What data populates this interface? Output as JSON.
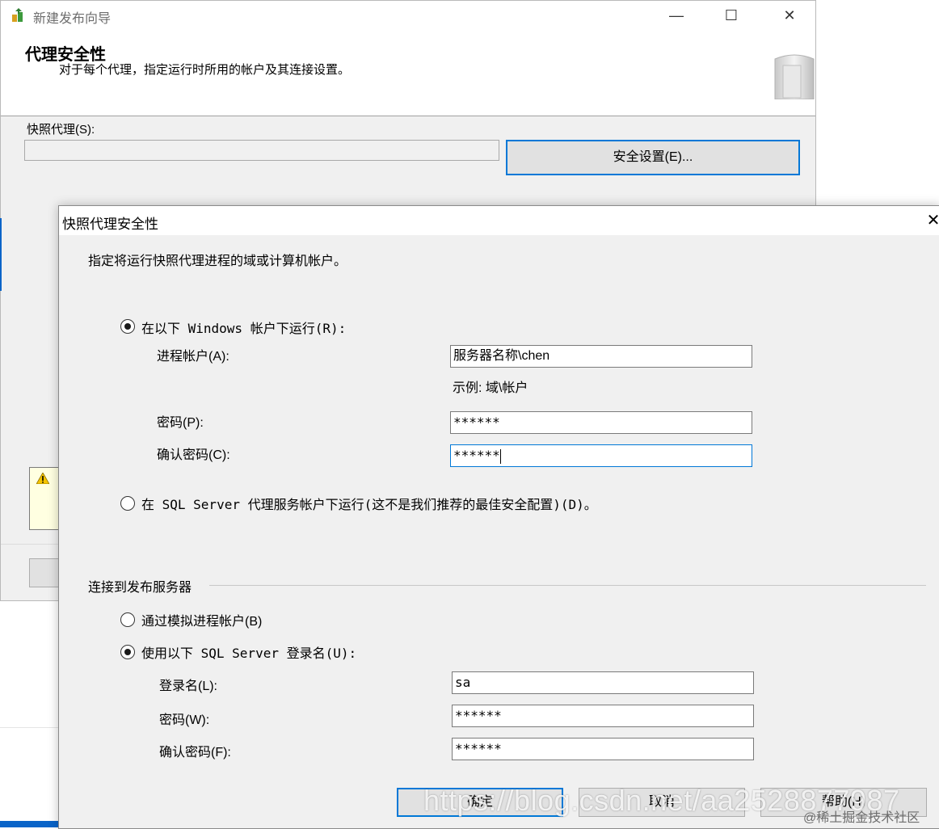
{
  "wizard": {
    "title": "新建发布向导",
    "header_title": "代理安全性",
    "header_desc": "对于每个代理，指定运行时所用的帐户及其连接设置。",
    "snapshot_agent_label": "快照代理(S):",
    "snapshot_agent_value": "",
    "security_settings_button": "安全设置(E)...",
    "minimize_glyph": "—",
    "maximize_glyph": "☐",
    "close_glyph": "✕"
  },
  "dialog": {
    "title": "快照代理安全性",
    "close_glyph": "✕",
    "instruction": "指定将运行快照代理进程的域或计算机帐户。",
    "process_account": {
      "radio_windows_label": "在以下 Windows 帐户下运行(R):",
      "account_label": "进程帐户(A):",
      "account_value": "服务器名称\\chen",
      "example_text": "示例: 域\\帐户",
      "password_label": "密码(P):",
      "password_value": "******",
      "confirm_label": "确认密码(C):",
      "confirm_value": "******",
      "radio_sqlagent_label": "在 SQL Server 代理服务帐户下运行(这不是我们推荐的最佳安全配置)(D)。",
      "selected": "windows"
    },
    "publisher_connection": {
      "group_title": "连接到发布服务器",
      "radio_impersonate_label": "通过模拟进程帐户(B)",
      "radio_sql_login_label": "使用以下 SQL Server 登录名(U):",
      "login_label": "登录名(L):",
      "login_value": "sa",
      "password_label": "密码(W):",
      "password_value": "******",
      "confirm_label": "确认密码(F):",
      "confirm_value": "******",
      "selected": "sql_login"
    },
    "buttons": {
      "ok": "确定",
      "cancel": "取消",
      "help": "帮助(H)"
    }
  },
  "watermark": {
    "url": "https://blog.csdn.net/aa2528877987",
    "community": "@稀土掘金技术社区"
  },
  "colors": {
    "accent": "#0078d7",
    "window_bg": "#f0f0f0",
    "warning_bg": "#ffffe1"
  }
}
